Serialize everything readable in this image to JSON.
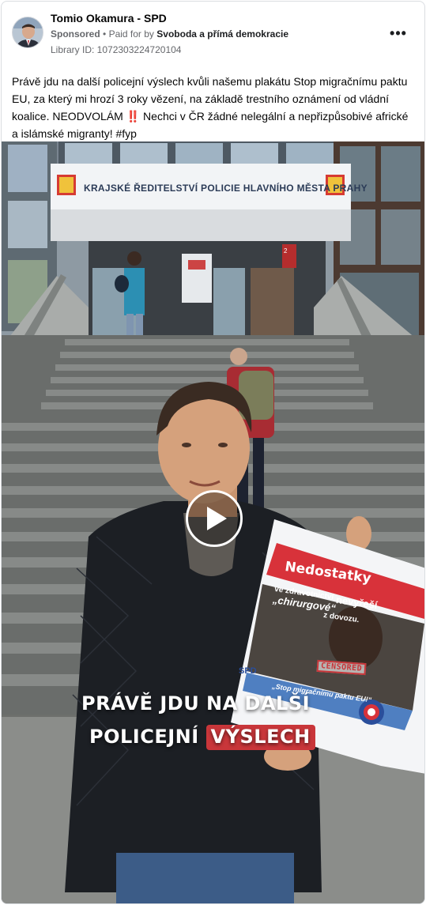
{
  "post": {
    "page_name": "Tomio Okamura - SPD",
    "sponsored_label": "Sponsored",
    "separator": "•",
    "paid_for_label": "Paid for by",
    "payer": "Svoboda a přímá demokracie",
    "library_id": "Library ID: 1072303224720104",
    "more_icon": "more-horizontal-icon",
    "text_part1": "Právě jdu na další policejní výslech kvůli našemu plakátu Stop migračnímu paktu EU, za který mi hrozí 3 roky vězení, na základě trestního oznámení od vládní koalice. NEODVOLÁM",
    "text_bang": "‼️",
    "text_part2": " Nechci v ČR žádné nelegální a nepřizpůsobivé africké a islámské migranty! #fyp"
  },
  "video": {
    "building_sign": "KRAJSKÉ ŘEDITELSTVÍ POLICIE HLAVNÍHO MĚSTA PRAHY",
    "door_sign_number": "2",
    "caption_line1": "PRÁVĚ JDU NA DALŠÍ",
    "caption_line2_prefix": "POLICEJNÍ ",
    "caption_line2_highlight": "VÝSLECH",
    "play_icon": "play-icon",
    "poster": {
      "title": "Nedostatky",
      "line1": "ve zdravotnictví",
      "line2": "nevyřeší",
      "line3": "„chirurgové“",
      "line4": "z dovozu.",
      "stamp": "CENSORED",
      "quote": "„Stop migračnímu paktu EU!“",
      "logo": "SPD"
    }
  },
  "colors": {
    "caption_highlight": "#c9363a",
    "poster_red": "#d8323a",
    "meta_gray": "#65676b"
  }
}
